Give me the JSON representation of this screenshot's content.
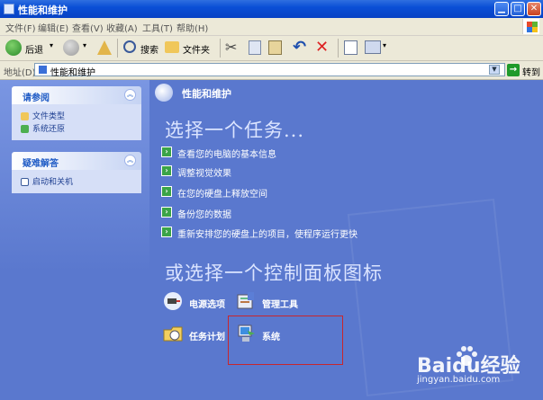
{
  "window": {
    "title": "性能和维护",
    "controls": {
      "minimize_icon": "minimize-icon",
      "maximize_icon": "maximize-icon",
      "close_icon": "close-icon"
    }
  },
  "menubar": {
    "items": [
      "文件(F)",
      "编辑(E)",
      "查看(V)",
      "收藏(A)",
      "工具(T)",
      "帮助(H)"
    ]
  },
  "toolbar": {
    "back_label": "后退",
    "search_label": "搜索",
    "folders_label": "文件夹"
  },
  "address": {
    "label": "地址(D)",
    "value": "性能和维护",
    "go_label": "转到"
  },
  "leftpane": {
    "see_also": {
      "title": "请参阅",
      "items": [
        "文件类型",
        "系统还原"
      ]
    },
    "troubleshoot": {
      "title": "疑难解答",
      "items": [
        "启动和关机"
      ]
    }
  },
  "main": {
    "page_title": "性能和维护",
    "task_heading": "选择一个任务...",
    "tasks": [
      "查看您的电脑的基本信息",
      "调整视觉效果",
      "在您的硬盘上释放空间",
      "备份您的数据",
      "重新安排您的硬盘上的项目，使程序运行更快"
    ],
    "cp_heading": "或选择一个控制面板图标",
    "cp_items": [
      "电源选项",
      "管理工具",
      "任务计划",
      "系统"
    ]
  },
  "watermark": {
    "text": "Baidu经验",
    "sub": "jingyan.baidu.com"
  },
  "colors": {
    "titlebar": "#0a4fd6",
    "content_bg": "#5a78ce",
    "task_arrow": "#3ba447",
    "highlight_box": "#c8262d"
  }
}
